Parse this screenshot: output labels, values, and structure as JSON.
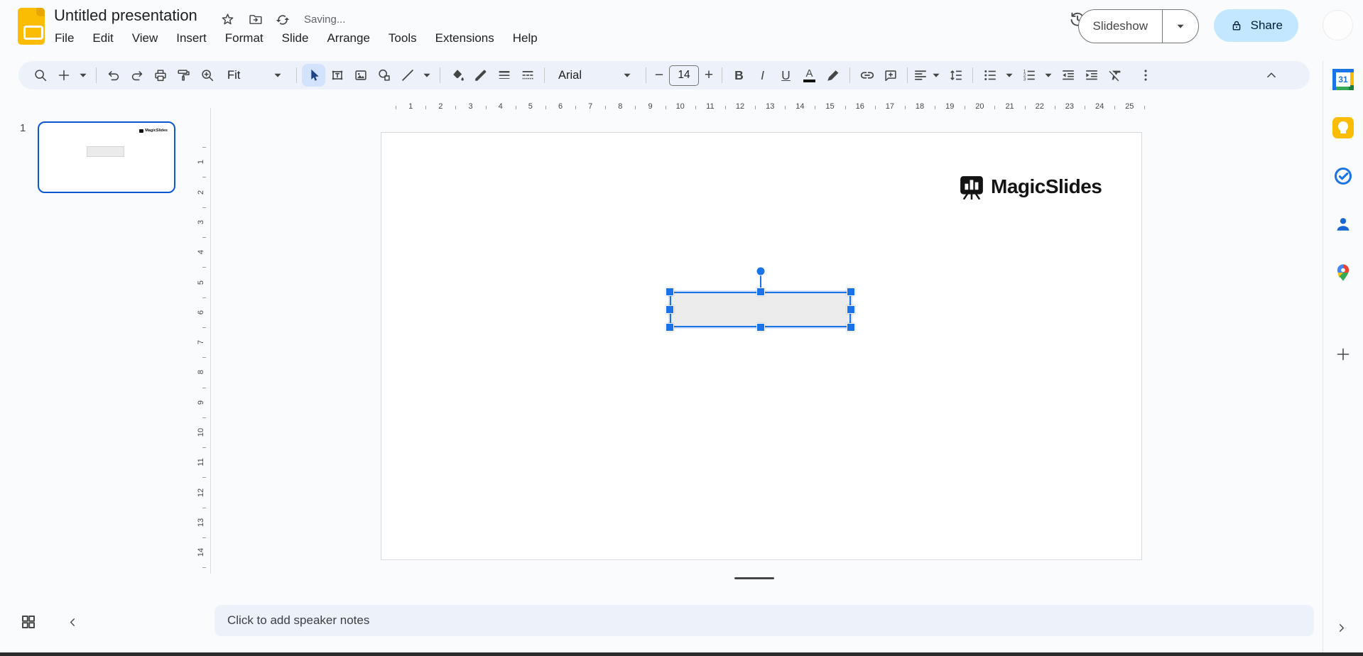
{
  "header": {
    "doc_title": "Untitled presentation",
    "saving_status": "Saving...",
    "menus": [
      "File",
      "Edit",
      "View",
      "Insert",
      "Format",
      "Slide",
      "Arrange",
      "Tools",
      "Extensions",
      "Help"
    ],
    "slideshow_label": "Slideshow",
    "share_label": "Share"
  },
  "toolbar": {
    "zoom_label": "Fit",
    "font_family": "Arial",
    "font_size": "14",
    "bold": "B",
    "italic": "I",
    "underline": "U",
    "text_color": "A"
  },
  "filmstrip": {
    "slide_number": "1"
  },
  "ruler": {
    "horizontal": [
      "1",
      "2",
      "3",
      "4",
      "5",
      "6",
      "7",
      "8",
      "9",
      "10",
      "11",
      "12",
      "13",
      "14",
      "15",
      "16",
      "17",
      "18",
      "19",
      "20",
      "21",
      "22",
      "23",
      "24",
      "25"
    ],
    "vertical": [
      "1",
      "2",
      "3",
      "4",
      "5",
      "6",
      "7",
      "8",
      "9",
      "10",
      "11",
      "12",
      "13",
      "14"
    ]
  },
  "slide": {
    "brand": "MagicSlides"
  },
  "notes": {
    "placeholder": "Click to add speaker notes"
  },
  "side_panel": {
    "calendar_day": "31"
  },
  "colors": {
    "accent_blue": "#1a73e8",
    "selection_blue": "#0b57d0",
    "share_pill": "#c2e7ff",
    "toolbar_pill": "#edf2fa",
    "selected_tool": "#d3e3fd",
    "slides_yellow": "#fbbc04"
  }
}
